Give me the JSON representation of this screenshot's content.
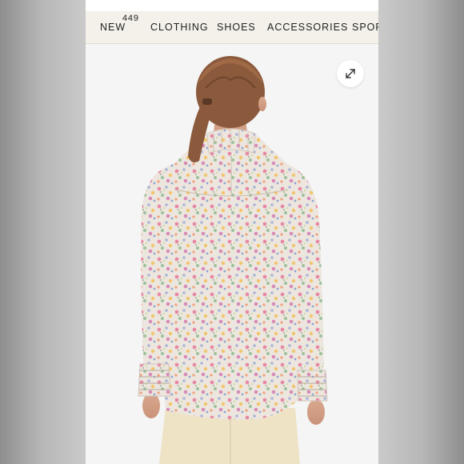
{
  "nav": {
    "items": [
      {
        "label": "NEW"
      },
      {
        "label": "CLOTHING"
      },
      {
        "label": "SHOES"
      },
      {
        "label": "ACCESSORIES"
      },
      {
        "label": "SPORT"
      }
    ],
    "badge": "449"
  },
  "product_image": {
    "subject": "model-back-view-floral-blouse"
  },
  "controls": {
    "expand_icon": "expand-arrows-icon"
  },
  "colors": {
    "nav_background": "#f4f1ea",
    "photo_background": "#f5f5f5",
    "blouse_base": "#e9e3dc",
    "pants": "#efe3c6",
    "hair": "#8b5a3c"
  }
}
